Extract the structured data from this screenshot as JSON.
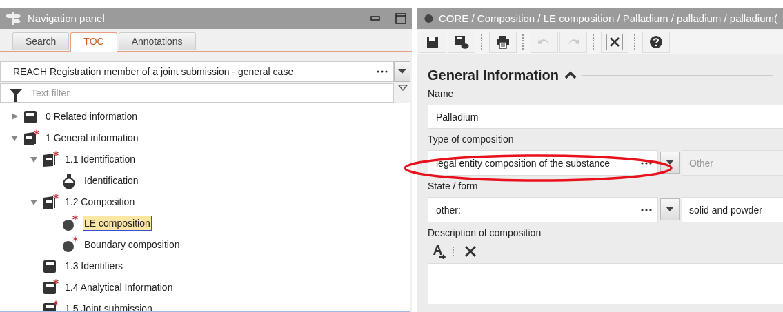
{
  "navigation_panel": {
    "title": "Navigation panel",
    "tabs": [
      {
        "label": "Search",
        "selected": false
      },
      {
        "label": "TOC",
        "selected": true
      },
      {
        "label": "Annotations",
        "selected": false
      }
    ],
    "template": {
      "value": "REACH Registration member of a joint submission - general case"
    },
    "filter": {
      "placeholder": "Text filter"
    },
    "tree": [
      {
        "label": "0 Related information",
        "kind": "record",
        "required": false,
        "expanded": false,
        "selected": false
      },
      {
        "label": "1 General information",
        "kind": "folder",
        "required": true,
        "expanded": true,
        "selected": false,
        "children": [
          {
            "label": "1.1 Identification",
            "kind": "folder",
            "required": true,
            "expanded": true,
            "selected": false,
            "children": [
              {
                "label": "Identification",
                "kind": "flask",
                "required": false,
                "selected": false
              }
            ]
          },
          {
            "label": "1.2 Composition",
            "kind": "folder",
            "required": true,
            "expanded": true,
            "selected": false,
            "children": [
              {
                "label": "LE composition",
                "kind": "sphere",
                "required": true,
                "selected": true
              },
              {
                "label": "Boundary composition",
                "kind": "sphere",
                "required": true,
                "selected": false
              }
            ]
          },
          {
            "label": "1.3 Identifiers",
            "kind": "record",
            "required": false,
            "selected": false
          },
          {
            "label": "1.4 Analytical Information",
            "kind": "record",
            "required": true,
            "selected": false
          },
          {
            "label": "1.5 Joint submission",
            "kind": "record",
            "required": true,
            "selected": false
          }
        ]
      }
    ]
  },
  "editor": {
    "title": "CORE / Composition / LE composition / Palladium / palladium / palladium(",
    "toolbar": [
      {
        "kind": "save",
        "disabled": false
      },
      {
        "kind": "save-comment",
        "disabled": false
      },
      {
        "kind": "print",
        "disabled": false
      },
      {
        "kind": "undo",
        "disabled": true
      },
      {
        "kind": "redo",
        "disabled": true
      },
      {
        "kind": "close",
        "disabled": false
      },
      {
        "kind": "help",
        "disabled": false
      }
    ],
    "section": {
      "title": "General Information",
      "expanded": true
    },
    "fields": [
      {
        "kind": "text",
        "label": "Name",
        "value": "Palladium"
      },
      {
        "kind": "picklist",
        "label": "Type of composition",
        "value": "legal entity composition of the substance",
        "other_placeholder": "Other"
      },
      {
        "kind": "picklist",
        "label": "State / form",
        "value": "other:",
        "other_value": "solid and powder"
      },
      {
        "kind": "richtext",
        "label": "Description of composition"
      }
    ]
  }
}
